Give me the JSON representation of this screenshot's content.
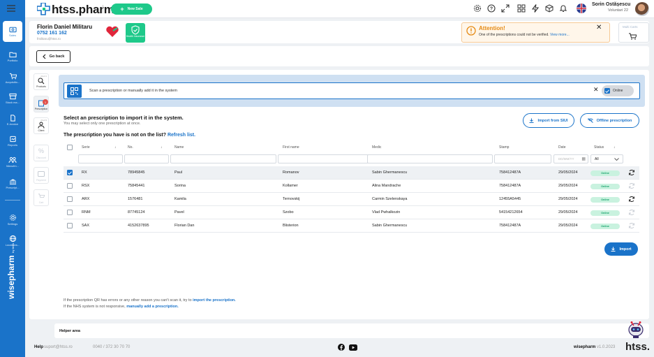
{
  "app": {
    "logo": "htss.pharm",
    "new_sale": "New Sale"
  },
  "user": {
    "name": "Sorin Ostășescu",
    "location": "Voluntari 22"
  },
  "sidebar": {
    "items": [
      {
        "label": "Sales",
        "icon": "cash-register-icon"
      },
      {
        "label": "Portfolio",
        "icon": "folder-icon"
      },
      {
        "label": "Acquisitio...",
        "icon": "cart-icon"
      },
      {
        "label": "Stock ma...",
        "icon": "box-icon"
      },
      {
        "label": "E-invoice",
        "icon": "file-icon"
      },
      {
        "label": "Reports",
        "icon": "report-icon"
      },
      {
        "label": "Manufm...",
        "icon": "people-icon"
      },
      {
        "label": "Prescript...",
        "icon": "bank-icon"
      },
      {
        "label": "Settings",
        "icon": "gear-icon"
      },
      {
        "label": "Locations...",
        "icon": "globe-icon"
      }
    ],
    "brand": "wisepharm",
    "brand_sub": "by htss"
  },
  "patient": {
    "name": "Florin Daniel Militaru",
    "phone": "0752 161 162",
    "email": "fmilitaru@htss.ro",
    "insured_label": "Health Insurance"
  },
  "attention": {
    "title": "Attention!",
    "text": "One of the prescriptions could not be verified.",
    "link": "View more..."
  },
  "multicart": {
    "label": "Multi Carts"
  },
  "goback": {
    "label": "Go back"
  },
  "tools": [
    {
      "label": "Products",
      "num": "Alt+F1"
    },
    {
      "label": "Prescription",
      "num": "Alt+F2",
      "badge": "1"
    },
    {
      "label": "Client",
      "num": "Alt+F3"
    },
    {
      "label": "Discount",
      "num": ""
    },
    {
      "label": "Payment",
      "num": ""
    },
    {
      "label": "Cart",
      "num": ""
    }
  ],
  "scan": {
    "placeholder": "Scan a prescription or manually add it in the system",
    "online_label": "Online"
  },
  "select": {
    "title": "Select an prescription to import it in the system.",
    "subtitle": "You may select only one prescription at once.",
    "not_on_list": "The prescription you have is not on the list?",
    "refresh": "Refresh list.",
    "import_siui": "Import from SIUI",
    "offline": "Offline prescription"
  },
  "table": {
    "headers": [
      "Serie",
      "No.",
      "Name",
      "First name",
      "Medic",
      "Stamp",
      "Date",
      "Status"
    ],
    "filter": {
      "date_placeholder": "DD/MM/YY",
      "status_value": "All"
    },
    "rows": [
      {
        "serie": "RX",
        "no": "78945845",
        "name": "Paul",
        "first_name": "Romanov",
        "medic": "Sabin Ghermanescu",
        "stamp": "758412487A",
        "date": "29/05/2024",
        "status": "Online",
        "selected": true,
        "sync_active": true
      },
      {
        "serie": "RSX",
        "no": "75845441",
        "name": "Sorina",
        "first_name": "Kollamer",
        "medic": "Alina Mandrache",
        "stamp": "758412487A",
        "date": "29/05/2024",
        "status": "Online",
        "selected": false,
        "sync_active": false
      },
      {
        "serie": "ARX",
        "no": "1576481",
        "name": "Kamila",
        "first_name": "Ternovskij",
        "medic": "Carmin Szelenskaya",
        "stamp": "12455A5445",
        "date": "29/05/2024",
        "status": "Online",
        "selected": false,
        "sync_active": true
      },
      {
        "serie": "RNM",
        "no": "87745124",
        "name": "Pavel",
        "first_name": "Szobo",
        "medic": "Vlad Pwhalkozin",
        "stamp": "54154212654",
        "date": "29/05/2024",
        "status": "Online",
        "selected": false,
        "sync_active": false
      },
      {
        "serie": "SAX",
        "no": "4152637895",
        "name": "Florian Dan",
        "first_name": "Blisterion",
        "medic": "Sabin Ghermanescu",
        "stamp": "758412487A",
        "date": "29/05/2024",
        "status": "Online",
        "selected": false,
        "sync_active": false
      }
    ]
  },
  "import_btn": "Import",
  "notes": {
    "line1": "If the prescription QR has errors or any other reason you can't scan it, try to",
    "line1_link": "import the prescription.",
    "line2": "If the NHS system is not responsive,",
    "line2_link": "manually add a prescription."
  },
  "helper": {
    "label": "Helper area"
  },
  "footer": {
    "help": "Help",
    "support": "suport@htss.ro",
    "phone": "0040 / 372 30 70 70",
    "brand": "wisepharm",
    "version": "v1.0.2023",
    "company": "htss."
  },
  "colors": {
    "primary": "#1a73c9",
    "accent": "#1ec98a",
    "warning": "#e58a14",
    "status_bg": "#c9f2df"
  }
}
